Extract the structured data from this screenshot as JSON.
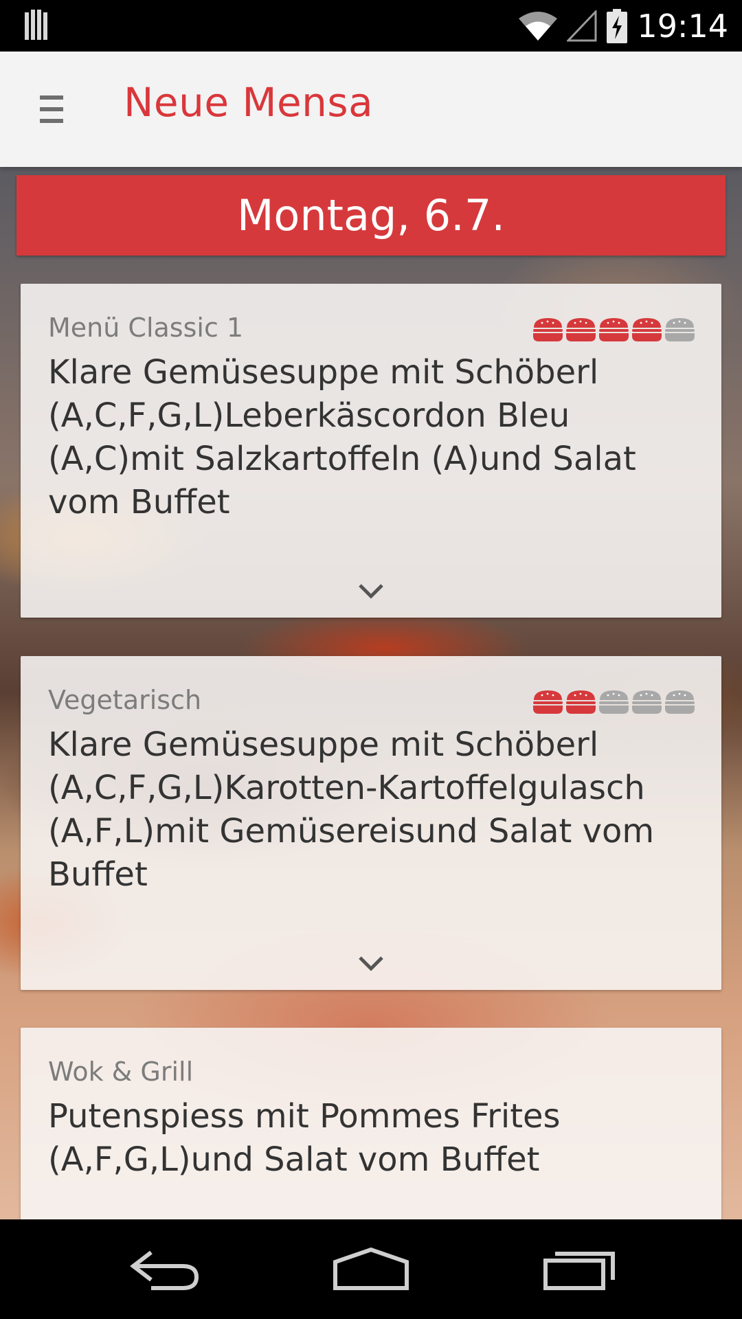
{
  "status_bar": {
    "time": "19:14",
    "icons": [
      "notification-bars-icon",
      "wifi-icon",
      "signal-icon",
      "battery-charging-icon"
    ]
  },
  "app_bar": {
    "title": "Neue Mensa",
    "menu_icon": "hamburger-menu-icon"
  },
  "date_banner": "Montag, 6.7.",
  "colors": {
    "accent": "#d6393c",
    "title_red": "#d9373b",
    "burger_active": "#d6393c",
    "burger_inactive": "#a8a8a8"
  },
  "menus": [
    {
      "category": "Menü Classic 1",
      "description": "Klare Gemüsesuppe mit Schöberl (A,C,F,G,L)Leberkäscordon Bleu (A,C)mit Salzkartoffeln (A)und Salat vom Buffet",
      "rating": 4,
      "rating_max": 5
    },
    {
      "category": "Vegetarisch",
      "description": "Klare Gemüsesuppe mit Schöberl (A,C,F,G,L)Karotten-Kartoffelgulasch (A,F,L)mit Gemüsereisund Salat vom Buffet",
      "rating": 2,
      "rating_max": 5
    },
    {
      "category": "Wok & Grill",
      "description": "Putenspiess mit Pommes Frites (A,F,G,L)und Salat vom Buffet"
    }
  ],
  "nav_bar": {
    "buttons": [
      "back-icon",
      "home-icon",
      "recent-apps-icon"
    ]
  }
}
